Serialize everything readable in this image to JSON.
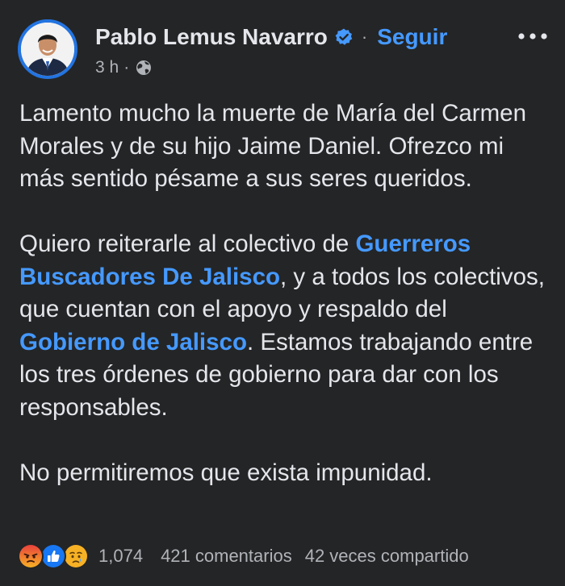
{
  "post": {
    "author": "Pablo Lemus Navarro",
    "verified_icon": "verified-badge-icon",
    "separator": "·",
    "follow_label": "Seguir",
    "more_icon": "more-options-icon",
    "time": "3 h",
    "time_separator": "·",
    "audience_icon": "globe-icon",
    "paragraph1": "Lamento mucho la muerte de María del Carmen Morales y de su hijo Jaime Daniel. Ofrezco mi más sentido pésame a sus seres queridos.",
    "p2_text1": "Quiero reiterarle al colectivo de ",
    "p2_mention1": "Guerreros Buscadores De Jalisco",
    "p2_text2": ", y a todos los colectivos, que cuentan con el apoyo y respaldo del ",
    "p2_mention2": "Gobierno de Jalisco",
    "p2_text3": ". Estamos trabajando entre los tres órdenes de gobierno para dar con los responsables.",
    "paragraph3": "No permitiremos que exista impunidad."
  },
  "footer": {
    "reaction_icons": [
      "angry-reaction-icon",
      "like-reaction-icon",
      "sad-reaction-icon"
    ],
    "reaction_count": "1,074",
    "comments": "421 comentarios",
    "shares": "42 veces compartido"
  },
  "colors": {
    "background": "#242526",
    "text": "#e4e6eb",
    "secondary_text": "#b0b3b8",
    "link": "#4599ff",
    "avatar_ring": "#2374e1"
  }
}
